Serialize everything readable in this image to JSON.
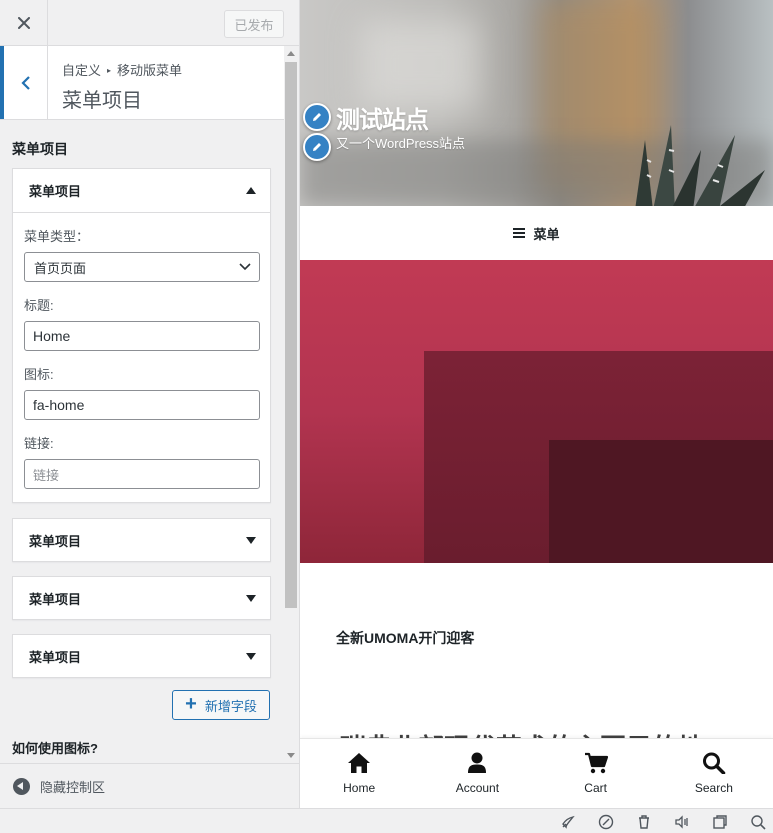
{
  "header": {
    "close_icon": "close-icon",
    "publish_label": "已发布"
  },
  "section": {
    "breadcrumb_root": "自定义",
    "breadcrumb_current": "移动版菜单",
    "title": "菜单项目"
  },
  "control_label": "菜单项目",
  "items": [
    {
      "label": "菜单项目",
      "expanded": true,
      "type_label": "菜单类型：",
      "type_value": "首页页面",
      "title_label": "标题:",
      "title_value": "Home",
      "icon_label": "图标:",
      "icon_value": "fa-home",
      "link_label": "链接:",
      "link_placeholder": "链接"
    },
    {
      "label": "菜单项目",
      "expanded": false
    },
    {
      "label": "菜单项目",
      "expanded": false
    },
    {
      "label": "菜单项目",
      "expanded": false
    }
  ],
  "add_field_label": "新增字段",
  "how_to_label": "如何使用图标?",
  "hide_controls_label": "隐藏控制区",
  "preview": {
    "site_title": "测试站点",
    "site_description": "又一个WordPress站点",
    "menu_label": "菜单",
    "subtitle": "全新UMOMA开门迎客",
    "heading_partial": "瑞典北部现代艺术的主要目的地",
    "bottom_nav": [
      {
        "label": "Home",
        "icon": "home-icon"
      },
      {
        "label": "Account",
        "icon": "user-icon"
      },
      {
        "label": "Cart",
        "icon": "cart-icon"
      },
      {
        "label": "Search",
        "icon": "search-icon"
      }
    ]
  },
  "colors": {
    "accent": "#2271b1",
    "cover": "#b23450",
    "edit_pin": "#3582c4"
  }
}
